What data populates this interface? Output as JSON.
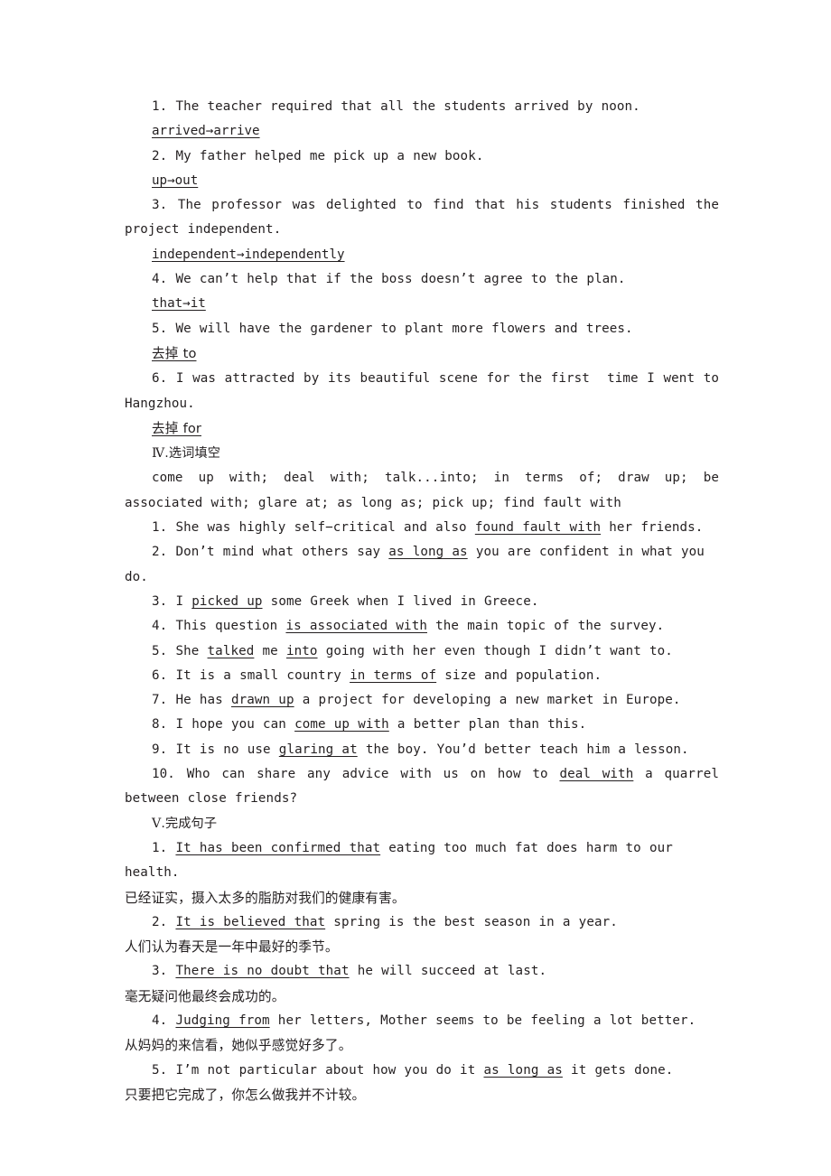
{
  "page": {
    "background_color": "#ffffff",
    "text_color": "#231f20"
  },
  "sections": [
    {
      "id": "error-correction",
      "items": [
        {
          "number": "1.",
          "sentence": "The teacher required that all the students arrived by noon.",
          "answer": "arrived→arrive"
        },
        {
          "number": "2.",
          "sentence": "My father helped me pick up a new book.",
          "answer": "up→out"
        },
        {
          "number": "3.",
          "sentence": "The professor was delighted to find that his students finished the project independent.",
          "answer": "independent→independently"
        },
        {
          "number": "4.",
          "sentence": "We can’t help that if the boss doesn’t agree to the plan.",
          "answer": "that→it"
        },
        {
          "number": "5.",
          "sentence": "We will have the gardener to plant more flowers and trees.",
          "answer": "去掉 to"
        },
        {
          "number": "6.",
          "sentence": "I was attracted by its beautiful scene for the first  time I went to Hangzhou.",
          "answer": "去掉 for"
        }
      ]
    },
    {
      "id": "word-bank-fill",
      "heading_numeral": "Ⅳ",
      "heading_text": ".选词填空",
      "word_bank": "come up with; deal with; talk...into; in terms of; draw up; be associated with; glare at; as long as; pick up; find fault with",
      "items": [
        {
          "number": "1.",
          "before": "She was highly self−critical and also ",
          "answer": "found fault with",
          "after": " her friends."
        },
        {
          "number": "2.",
          "before": "Don’t mind what others say ",
          "answer": "as long as",
          "after": " you are confident in what you do."
        },
        {
          "number": "3.",
          "before": "I ",
          "answer": "picked up",
          "after": " some Greek when I lived in Greece."
        },
        {
          "number": "4.",
          "before": "This question ",
          "answer": "is associated with",
          "after": " the main topic of the survey."
        },
        {
          "number": "5.",
          "before": "She ",
          "answer": "talked",
          "mid": " me ",
          "answer2": "into",
          "after": " going with her even though I didn’t want to."
        },
        {
          "number": "6.",
          "before": "It is a small country ",
          "answer": "in terms of",
          "after": " size and population."
        },
        {
          "number": "7.",
          "before": "He has ",
          "answer": "drawn up",
          "after": " a project for developing a new market in Europe."
        },
        {
          "number": "8.",
          "before": "I hope you can ",
          "answer": "come up with",
          "after": " a better plan than this."
        },
        {
          "number": "9.",
          "before": "It is no use ",
          "answer": "glaring at",
          "after": " the boy. You’d better teach him a lesson."
        },
        {
          "number": "10.",
          "before": "Who can share any advice with us on how to ",
          "answer": "deal with",
          "after": " a quarrel between close friends?"
        }
      ]
    },
    {
      "id": "sentence-completion",
      "heading_numeral": "Ⅴ",
      "heading_text": ".完成句子",
      "items": [
        {
          "number": "1.",
          "before": "",
          "answer": "It has been confirmed that",
          "after": " eating too much fat does harm to our health.",
          "translation": "已经证实，摄入太多的脂肪对我们的健康有害。"
        },
        {
          "number": "2.",
          "before": "",
          "answer": "It is believed that",
          "after": " spring is the best season in a year.",
          "translation": "人们认为春天是一年中最好的季节。"
        },
        {
          "number": "3.",
          "before": "",
          "answer": "There is no doubt that",
          "after": " he will succeed at last.",
          "translation": "毫无疑问他最终会成功的。"
        },
        {
          "number": "4.",
          "before": "",
          "answer": "Judging from",
          "after": " her letters, Mother seems to be feeling a lot better.",
          "translation": "从妈妈的来信看，她似乎感觉好多了。"
        },
        {
          "number": "5.",
          "before": "I’m not particular about how you do it ",
          "answer": "as long as",
          "after": " it gets done.",
          "translation": "只要把它完成了，你怎么做我并不计较。"
        }
      ]
    }
  ]
}
